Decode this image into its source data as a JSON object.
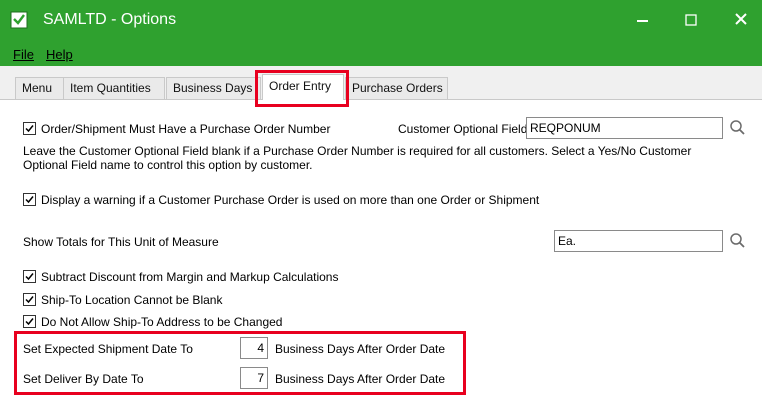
{
  "window": {
    "title": "SAMLTD - Options",
    "minimize_glyph": "—",
    "maximize_glyph": "☐",
    "close_glyph": "✕"
  },
  "menu": [
    {
      "label": "File"
    },
    {
      "label": "Help"
    }
  ],
  "tabs": [
    {
      "label": "Menu"
    },
    {
      "label": "Item Quantities"
    },
    {
      "label": "Business Days"
    },
    {
      "label": "Order Entry",
      "active": true
    },
    {
      "label": "Purchase Orders"
    }
  ],
  "order_entry": {
    "require_po": {
      "label": "Order/Shipment Must Have a Purchase Order Number",
      "checked": true
    },
    "customer_optional_field": {
      "label": "Customer Optional Field",
      "value": "REQPONUM"
    },
    "help_text_line1": "Leave the Customer Optional Field blank if a Purchase Order Number is required for all customers. Select a Yes/No Customer",
    "help_text_line2": "Optional Field name to control this option by customer.",
    "warn_duplicate_po": {
      "label": "Display a warning if a Customer Purchase Order is used on more than one Order or Shipment",
      "checked": true
    },
    "unit_of_measure": {
      "label": "Show Totals for This Unit of Measure",
      "value": "Ea."
    },
    "subtract_discount": {
      "label": "Subtract Discount from Margin and Markup Calculations",
      "checked": true
    },
    "shipto_not_blank": {
      "label": "Ship-To Location Cannot be Blank",
      "checked": true
    },
    "no_shipto_change": {
      "label": "Do Not Allow Ship-To Address to be Changed",
      "checked": true
    },
    "expected_ship_date": {
      "label": "Set Expected Shipment Date To",
      "value": "4",
      "suffix": "Business Days After Order Date"
    },
    "deliver_by_date": {
      "label": "Set Deliver By Date To",
      "value": "7",
      "suffix": "Business Days After Order Date"
    }
  },
  "colors": {
    "titlebar": "#2fa12f",
    "highlight": "#e8001f"
  },
  "icons": {
    "app": "app-icon",
    "finder": "search-icon",
    "check": "checkmark-icon"
  }
}
